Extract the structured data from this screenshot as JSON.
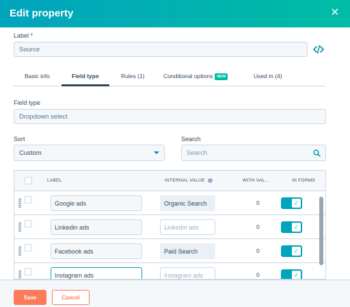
{
  "header": {
    "title": "Edit property",
    "close_icon": "×"
  },
  "label_field": {
    "label": "Label *",
    "value": "Source"
  },
  "tabs": [
    {
      "label": "Basic info",
      "active": false
    },
    {
      "label": "Field type",
      "active": true
    },
    {
      "label": "Rules (1)",
      "active": false
    },
    {
      "label": "Conditional options",
      "badge": "NEW",
      "active": false
    },
    {
      "label": "Used in (4)",
      "active": false
    }
  ],
  "field_type": {
    "label": "Field type",
    "value": "Dropdown select"
  },
  "sort": {
    "label": "Sort",
    "value": "Custom"
  },
  "search": {
    "label": "Search",
    "placeholder": "Search"
  },
  "table": {
    "columns": {
      "label": "LABEL",
      "internal_value": "INTERNAL VALUE",
      "with_values": "WITH VAL...",
      "in_forms": "IN FORMS"
    },
    "rows": [
      {
        "label": "Google ads",
        "internal": "Organic Search",
        "count": "0",
        "in_forms": true
      },
      {
        "label": "Linkedin ads",
        "internal": "Linkedin ads",
        "count": "0",
        "in_forms": true
      },
      {
        "label": "Facebook ads",
        "internal": "Paid Search",
        "count": "0",
        "in_forms": true
      },
      {
        "label": "Instagram ads",
        "internal": "Instagram ads",
        "count": "0",
        "in_forms": true
      }
    ]
  },
  "footer": {
    "save_label": "Save",
    "cancel_label": "Cancel"
  },
  "colors": {
    "accent": "#00a4bd",
    "cta": "#ff7a59",
    "text": "#33475b"
  }
}
